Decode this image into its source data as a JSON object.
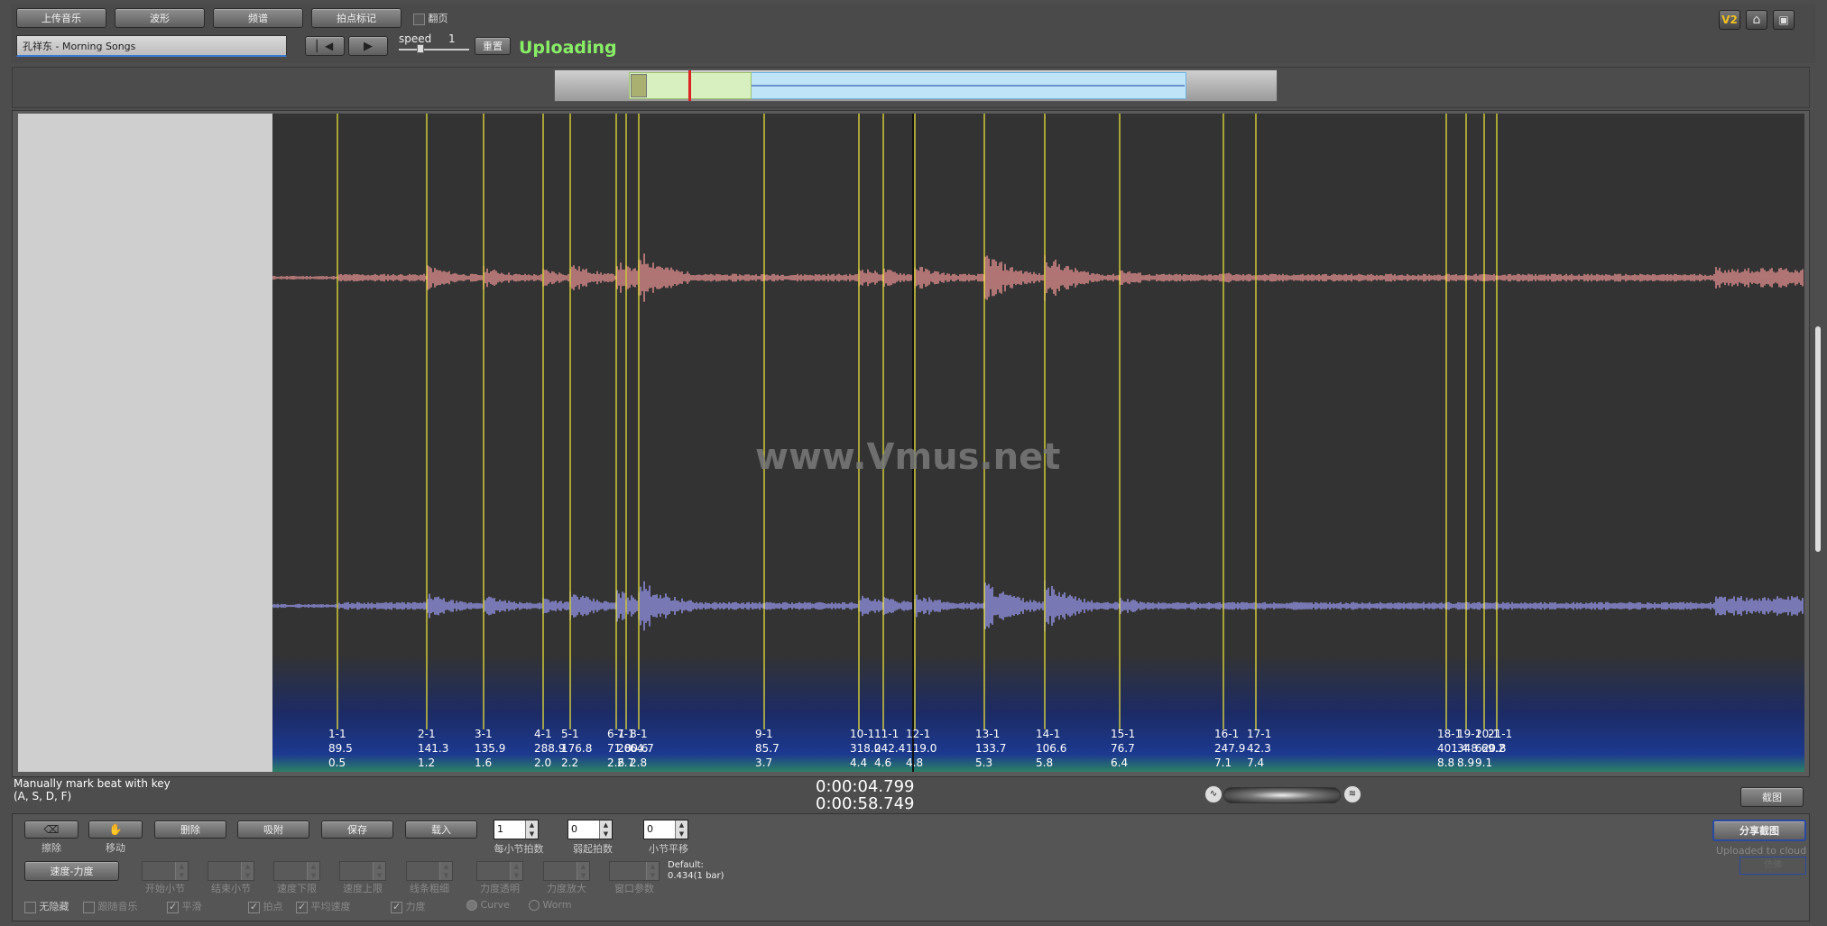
{
  "toolbar": {
    "upload_music": "上传音乐",
    "waveform": "波形",
    "spectrum": "频谱",
    "beat_mark": "拍点标记",
    "page_turn_label": "翻页",
    "track_name": "孔祥东 - Morning Songs",
    "speed_label": "speed",
    "speed_value": "1",
    "reset_label": "重置",
    "status": "Uploading"
  },
  "watermark": "www.Vmus.net",
  "markers": [
    {
      "label": "1-1",
      "tempo": "89.5",
      "time": "0.5"
    },
    {
      "label": "2-1",
      "tempo": "141.3",
      "time": "1.2"
    },
    {
      "label": "3-1",
      "tempo": "135.9",
      "time": "1.6"
    },
    {
      "label": "4-1",
      "tempo": "288.9",
      "time": "2.0"
    },
    {
      "label": "5-1",
      "tempo": "176.8",
      "time": "2.2"
    },
    {
      "label": "6-1",
      "tempo": "71.8",
      "time": "2.6"
    },
    {
      "label": "7-1",
      "tempo": "200.6",
      "time": "2.7"
    },
    {
      "label": "8-1",
      "tempo": "64.7",
      "time": "2.8"
    },
    {
      "label": "9-1",
      "tempo": "85.7",
      "time": "3.7"
    },
    {
      "label": "10-1",
      "tempo": "318.0",
      "time": "4.4"
    },
    {
      "label": "11-1",
      "tempo": "242.4",
      "time": "4.6"
    },
    {
      "label": "12-1",
      "tempo": "119.0",
      "time": "4.8"
    },
    {
      "label": "13-1",
      "tempo": "133.7",
      "time": "5.3"
    },
    {
      "label": "14-1",
      "tempo": "106.6",
      "time": "5.8"
    },
    {
      "label": "15-1",
      "tempo": "76.7",
      "time": "6.4"
    },
    {
      "label": "16-1",
      "tempo": "247.9",
      "time": "7.1"
    },
    {
      "label": "17-1",
      "tempo": "42.3",
      "time": "7.4"
    },
    {
      "label": "18-1",
      "tempo": "401.4",
      "time": "8.8"
    },
    {
      "label": "19-1",
      "tempo": "348.6",
      "time": "8.9"
    },
    {
      "label": "20-1",
      "tempo": "620.8",
      "time": "9.1"
    },
    {
      "label": "21-1",
      "tempo": "",
      "time": "9.2"
    }
  ],
  "info": {
    "hint_line1": "Manually mark beat with key",
    "hint_line2": "(A, S, D, F)",
    "current_time": "0:00:04.799",
    "total_time": "0:00:58.749",
    "screenshot_label": "截图"
  },
  "bottom": {
    "erase_label": "擦除",
    "move_label": "移动",
    "delete_label": "删除",
    "snap_label": "吸附",
    "save_label": "保存",
    "load_label": "载入",
    "beats_per_bar_value": "1",
    "beats_per_bar_label": "每小节拍数",
    "pickup_value": "0",
    "pickup_label": "弱起拍数",
    "bar_offset_value": "0",
    "bar_offset_label": "小节平移",
    "tempo_dynamics": "速度-力度",
    "start_bar": "开始小节",
    "end_bar": "结束小节",
    "tempo_lower": "速度下限",
    "tempo_upper": "速度上限",
    "line_width": "线条粗细",
    "dyn_alpha": "力度透明",
    "dyn_zoom": "力度放大",
    "window_param": "窗口参数",
    "default_line1": "Default:",
    "default_line2": "0.434(1 bar)",
    "opt_no_hide": "无隐藏",
    "opt_follow_music": "跟随音乐",
    "opt_smooth": "平滑",
    "opt_beat": "拍点",
    "opt_avg_tempo": "平均速度",
    "opt_dynamics": "力度",
    "opt_curve": "Curve",
    "opt_worm": "Worm",
    "share_screenshot": "分享截图",
    "uploaded_to_cloud": "Uploaded to cloud",
    "cloud_small_btn": "仿佛"
  },
  "colors": {
    "marker": "#e8e03a",
    "left_channel": "#d98a8a",
    "right_channel": "#8f8fe0",
    "status": "#88ee66"
  }
}
